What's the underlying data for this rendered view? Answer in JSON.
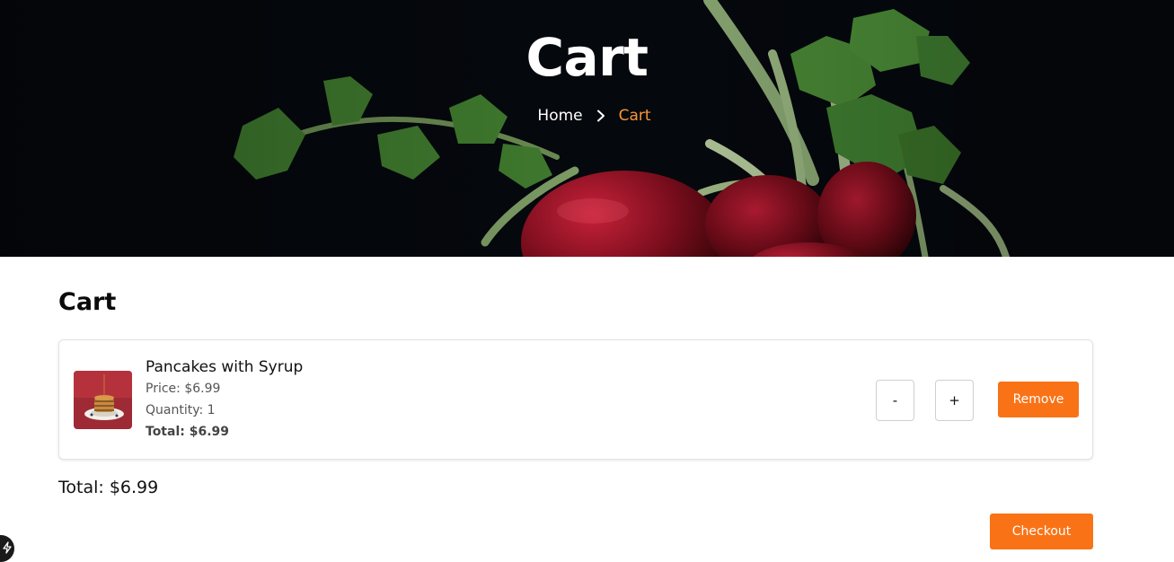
{
  "hero": {
    "title": "Cart",
    "breadcrumb": {
      "home_label": "Home",
      "separator_icon": "chevron-right-icon",
      "current_label": "Cart"
    }
  },
  "main": {
    "section_title": "Cart",
    "cart_items": [
      {
        "name": "Pancakes with Syrup",
        "price_text": "Price: $6.99",
        "quantity_text": "Quantity: 1",
        "total_text": "Total: $6.99",
        "decrement_label": "-",
        "increment_label": "+",
        "remove_label": "Remove",
        "thumbnail_icon": "pancakes-image"
      }
    ],
    "grand_total": "Total: $6.99",
    "checkout_label": "Checkout"
  },
  "floating_badge_icon": "bolt-icon",
  "colors": {
    "accent": "#f97316",
    "breadcrumb_active": "#f7953a",
    "hero_bg": "#05080d"
  }
}
